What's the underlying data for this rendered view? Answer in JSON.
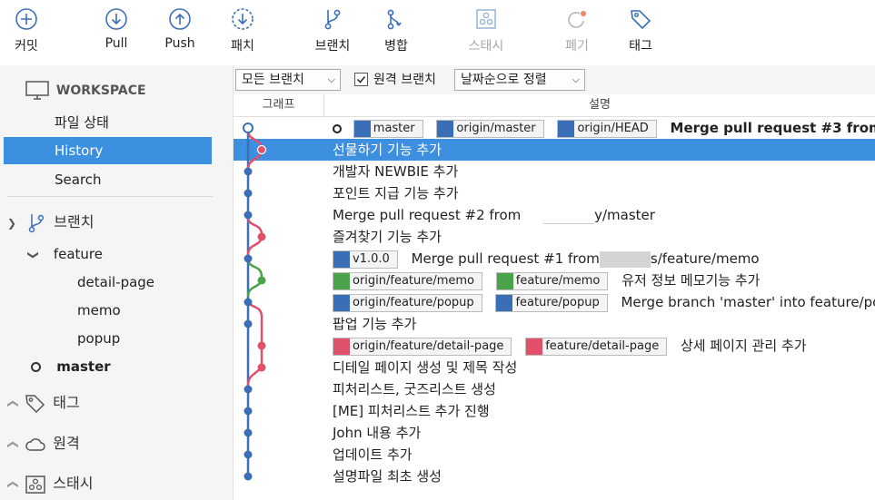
{
  "toolbar": {
    "commit": "커밋",
    "pull": "Pull",
    "push": "Push",
    "patch": "패치",
    "branch": "브랜치",
    "merge": "병합",
    "stash": "스태시",
    "discard": "폐기",
    "tag": "태그"
  },
  "sidebar": {
    "workspace": "WORKSPACE",
    "file_status": "파일 상태",
    "history": "History",
    "search": "Search",
    "branches": "브랜치",
    "feature": "feature",
    "detail_page": "detail-page",
    "memo": "memo",
    "popup": "popup",
    "master": "master",
    "tags": "태그",
    "remotes": "원격",
    "stashes": "스태시"
  },
  "filter": {
    "all_branches": "모든 브랜치",
    "remote_branches": "원격 브랜치",
    "sort": "날짜순으로 정렬"
  },
  "columns": {
    "graph": "그래프",
    "description": "설명"
  },
  "commits": [
    {
      "refs": [
        "master",
        "origin/master",
        "origin/HEAD"
      ],
      "message": "Merge pull request #3 from"
    },
    {
      "message": "선물하기 기능 추가"
    },
    {
      "message": "개발자 NEWBIE 추가"
    },
    {
      "message": "포인트 지급 기능 추가"
    },
    {
      "message_a": "Merge pull request #2 from",
      "message_b": "y/master"
    },
    {
      "message": "즐겨찾기 기능 추가"
    },
    {
      "tag": "v1.0.0",
      "message_a": "Merge pull request #1 from",
      "message_b": "s/feature/memo"
    },
    {
      "refs": [
        "origin/feature/memo",
        "feature/memo"
      ],
      "message": "유저 정보 메모기능 추가"
    },
    {
      "refs": [
        "origin/feature/popup",
        "feature/popup"
      ],
      "message": "Merge branch 'master' into feature/pc"
    },
    {
      "message": "팝업 기능 추가"
    },
    {
      "refs": [
        "origin/feature/detail-page",
        "feature/detail-page"
      ],
      "message": "상세 페이지 관리 추가"
    },
    {
      "message": "디테일 페이지 생성 및 제목 작성"
    },
    {
      "message": "피처리스트, 굿즈리스트 생성"
    },
    {
      "message": "[ME] 피처리스트 추가 진행"
    },
    {
      "message": "John 내용 추가"
    },
    {
      "message": "업데이트 추가"
    },
    {
      "message": "설명파일 최초 생성"
    }
  ],
  "colors": {
    "selection": "#3d8fe0",
    "lane_main": "#3a6fb8",
    "lane_red": "#e0506a",
    "lane_green": "#4aa24a"
  }
}
